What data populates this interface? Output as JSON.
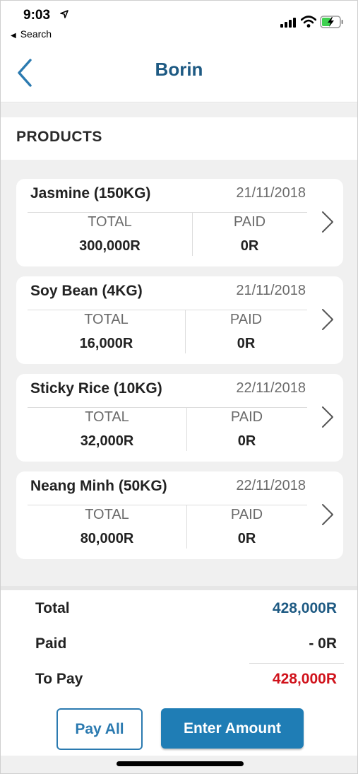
{
  "status_bar": {
    "time": "9:03",
    "back_to_app": "Search"
  },
  "header": {
    "title": "Borin"
  },
  "section": {
    "title": "PRODUCTS"
  },
  "products": [
    {
      "name": "Jasmine (150KG)",
      "date": "21/11/2018",
      "total_label": "TOTAL",
      "total": "300,000R",
      "paid_label": "PAID",
      "paid": "0R"
    },
    {
      "name": "Soy Bean (4KG)",
      "date": "21/11/2018",
      "total_label": "TOTAL",
      "total": "16,000R",
      "paid_label": "PAID",
      "paid": "0R"
    },
    {
      "name": "Sticky Rice (10KG)",
      "date": "22/11/2018",
      "total_label": "TOTAL",
      "total": "32,000R",
      "paid_label": "PAID",
      "paid": "0R"
    },
    {
      "name": "Neang Minh (50KG)",
      "date": "22/11/2018",
      "total_label": "TOTAL",
      "total": "80,000R",
      "paid_label": "PAID",
      "paid": "0R"
    }
  ],
  "summary": {
    "total_label": "Total",
    "total_value": "428,000R",
    "paid_label": "Paid",
    "paid_value": "- 0R",
    "to_pay_label": "To Pay",
    "to_pay_value": "428,000R"
  },
  "actions": {
    "pay_all": "Pay All",
    "enter_amount": "Enter Amount"
  },
  "colors": {
    "brand_blue": "#1e5a83",
    "button_blue": "#1f7db5",
    "total_blue": "#1e5a83",
    "to_pay_red": "#d0121b"
  }
}
